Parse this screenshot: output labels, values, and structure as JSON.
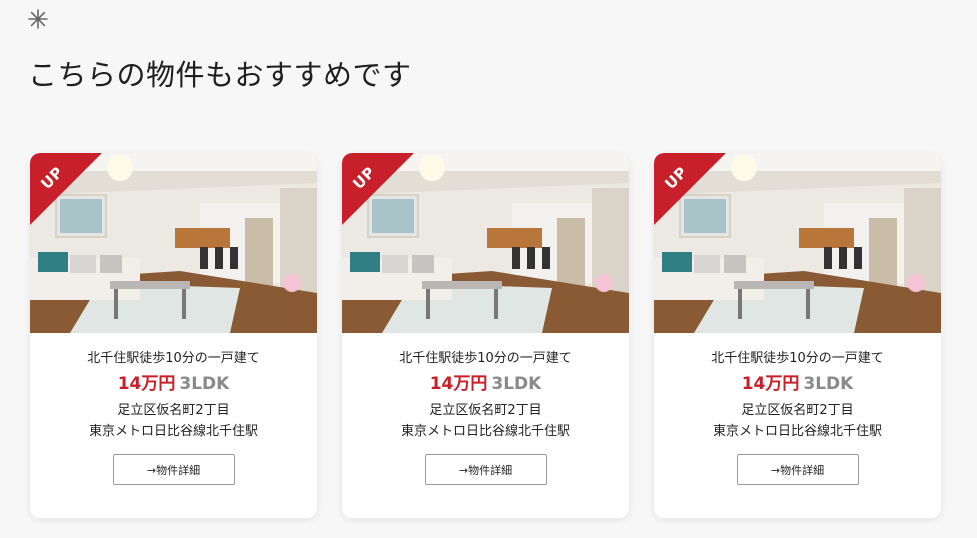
{
  "header": {
    "icon": "asterisk-icon",
    "title": "こちらの物件もおすすめです"
  },
  "colors": {
    "accent": "#c8202a",
    "muted": "#8a8a8a",
    "background": "#f7f7f7"
  },
  "cards": [
    {
      "badge": "UP",
      "name": "北千住駅徒歩10分の一戸建て",
      "price": "14万円",
      "layout": "3LDK",
      "address": "足立区仮名町2丁目",
      "station": "東京メトロ日比谷線北千住駅",
      "button_label": "→物件詳細"
    },
    {
      "badge": "UP",
      "name": "北千住駅徒歩10分の一戸建て",
      "price": "14万円",
      "layout": "3LDK",
      "address": "足立区仮名町2丁目",
      "station": "東京メトロ日比谷線北千住駅",
      "button_label": "→物件詳細"
    },
    {
      "badge": "UP",
      "name": "北千住駅徒歩10分の一戸建て",
      "price": "14万円",
      "layout": "3LDK",
      "address": "足立区仮名町2丁目",
      "station": "東京メトロ日比谷線北千住駅",
      "button_label": "→物件詳細"
    }
  ]
}
